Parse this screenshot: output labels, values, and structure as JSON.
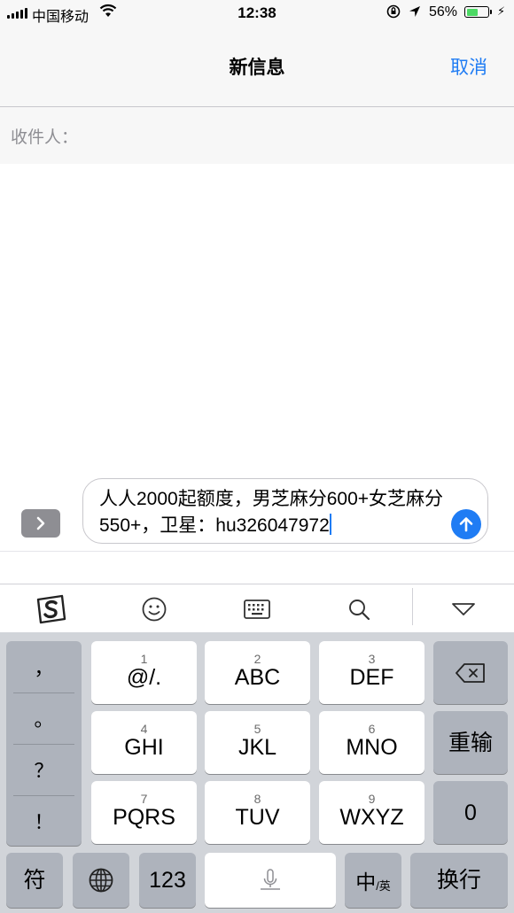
{
  "status_bar": {
    "carrier": "中国移动",
    "time": "12:38",
    "battery_percent": "56%",
    "battery_level": 0.56,
    "icons": [
      "signal-icon",
      "wifi-icon",
      "rotation-lock-icon",
      "location-icon",
      "battery-icon",
      "charging-icon"
    ]
  },
  "nav": {
    "title": "新信息",
    "cancel_label": "取消"
  },
  "recipient": {
    "label": "收件人："
  },
  "compose": {
    "message_text": "人人2000起额度，男芝麻分600+女芝麻分550+，卫星：hu326047972",
    "accent_color": "#1f7cf4"
  },
  "keyboard_toolbar": {
    "icons": [
      "sogou-logo-icon",
      "emoji-icon",
      "keyboard-icon",
      "search-icon",
      "collapse-keyboard-icon"
    ]
  },
  "keyboard": {
    "punctuation": [
      "，",
      "。",
      "？",
      "！"
    ],
    "keys": [
      {
        "num": "1",
        "label": "@/."
      },
      {
        "num": "2",
        "label": "ABC"
      },
      {
        "num": "3",
        "label": "DEF"
      },
      {
        "num": "4",
        "label": "GHI"
      },
      {
        "num": "5",
        "label": "JKL"
      },
      {
        "num": "6",
        "label": "MNO"
      },
      {
        "num": "7",
        "label": "PQRS"
      },
      {
        "num": "8",
        "label": "TUV"
      },
      {
        "num": "9",
        "label": "WXYZ"
      }
    ],
    "reinput_label": "重输",
    "zero_label": "0",
    "symbol_label": "符",
    "numeric_label": "123",
    "lang_main": "中",
    "lang_sub": "/英",
    "return_label": "换行"
  }
}
